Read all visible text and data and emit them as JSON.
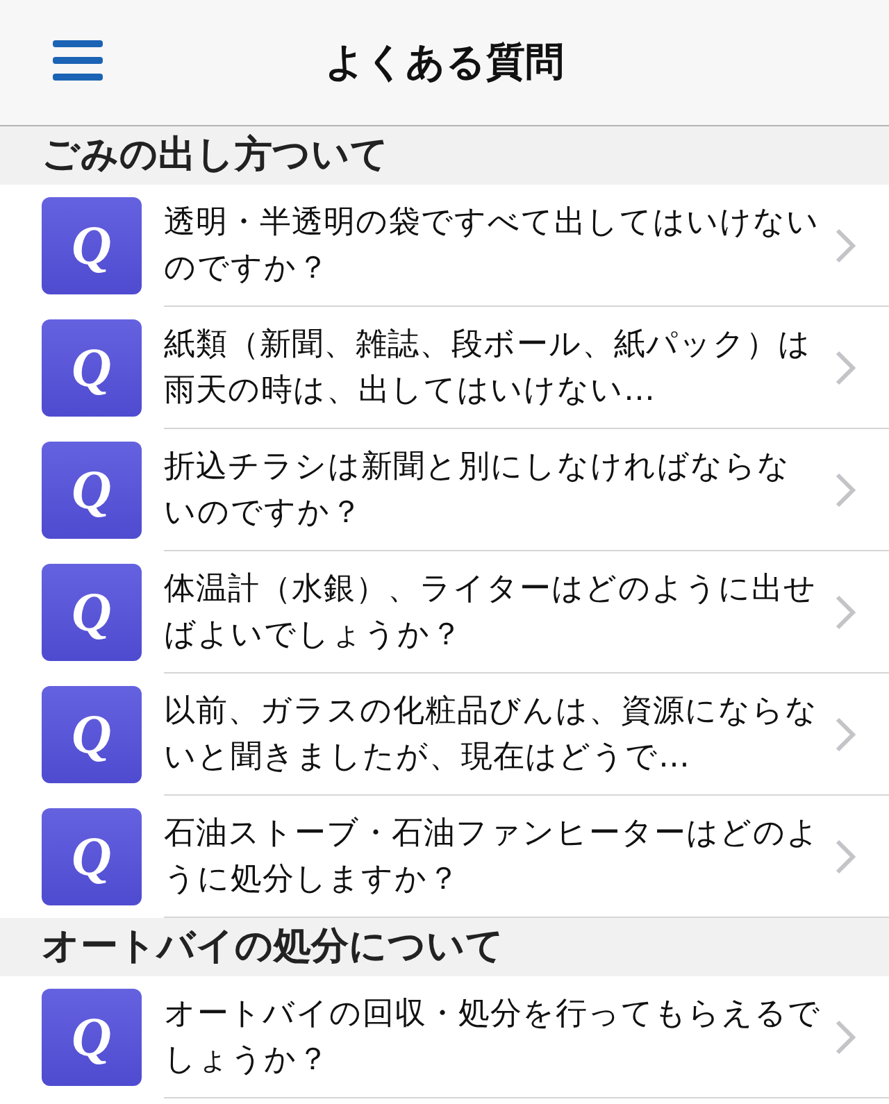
{
  "header": {
    "title": "よくある質問"
  },
  "sections": [
    {
      "title": "ごみの出し方ついて",
      "items": [
        {
          "icon_letter": "Q",
          "text": "透明・半透明の袋ですべて出してはいけないのですか？"
        },
        {
          "icon_letter": "Q",
          "text": "紙類（新聞、雑誌、段ボール、紙パック）は雨天の時は、出してはいけない…"
        },
        {
          "icon_letter": "Q",
          "text": "折込チラシは新聞と別にしなければならないのですか？"
        },
        {
          "icon_letter": "Q",
          "text": "体温計（水銀）、ライターはどのように出せばよいでしょうか？"
        },
        {
          "icon_letter": "Q",
          "text": "以前、ガラスの化粧品びんは、資源にならないと聞きましたが、現在はどうで…"
        },
        {
          "icon_letter": "Q",
          "text": "石油ストーブ・石油ファンヒーターはどのように処分しますか？"
        }
      ]
    },
    {
      "title": "オートバイの処分について",
      "items": [
        {
          "icon_letter": "Q",
          "text": "オートバイの回収・処分を行ってもらえるでしょうか？"
        }
      ]
    }
  ]
}
